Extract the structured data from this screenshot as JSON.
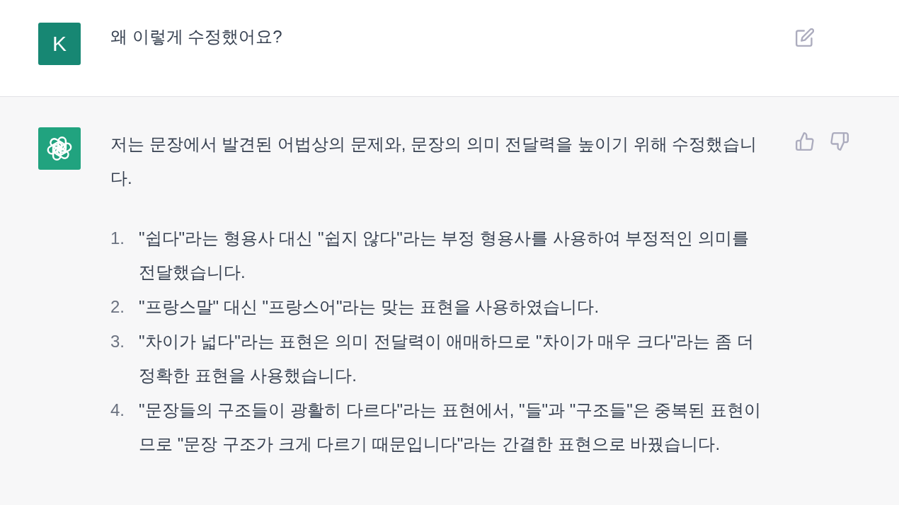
{
  "messages": [
    {
      "kind": "user",
      "avatar": "K",
      "text": "왜 이렇게 수정했어요?"
    },
    {
      "kind": "assistant",
      "paragraphs": [
        "저는 문장에서 발견된 어법상의 문제와, 문장의 의미 전달력을 높이기 위해 수정했습니다."
      ],
      "list": [
        {
          "number": "1.",
          "text": "\"쉽다\"라는 형용사 대신 \"쉽지 않다\"라는 부정 형용사를 사용하여 부정적인 의미를 전달했습니다."
        },
        {
          "number": "2.",
          "text": "\"프랑스말\" 대신 \"프랑스어\"라는 맞는 표현을 사용하였습니다."
        },
        {
          "number": "3.",
          "text": "\"차이가 넓다\"라는 표현은 의미 전달력이 애매하므로 \"차이가 매우 크다\"라는 좀 더 정확한 표현을 사용했습니다."
        },
        {
          "number": "4.",
          "text": "\"문장들의 구조들이 광활히 다르다\"라는 표현에서, \"들\"과 \"구조들\"은 중복된 표현이므로 \"문장 구조가 크게 다르기 때문입니다\"라는 간결한 표현으로 바꿨습니다."
        }
      ]
    }
  ]
}
